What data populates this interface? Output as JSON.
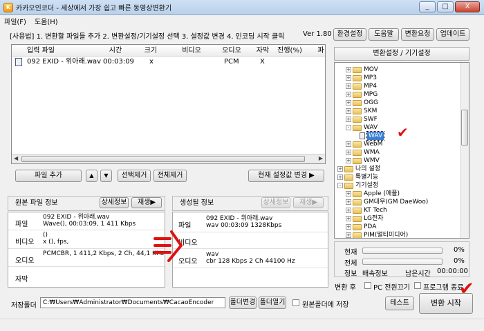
{
  "window": {
    "title": "카카오인코더 - 세상에서 가장 쉽고 빠른 동영상변환기",
    "controls": [
      "_",
      "□",
      "X"
    ]
  },
  "menu": [
    "파일(F)",
    "도움(H)"
  ],
  "instruction": "[사용법] 1. 변환할 파일들 추가  2. 변환설정/기기설정 선택  3. 설정값 변경  4. 인코딩 시작 클릭",
  "version": "Ver 1.80",
  "top_buttons": [
    "환경설정",
    "도움말",
    "변환요청",
    "업데이트"
  ],
  "file_list": {
    "columns": [
      "입력 파일",
      "시간",
      "크기",
      "비디오",
      "오디오",
      "자막",
      "진행(%)",
      "파"
    ],
    "rows": [
      {
        "file": "092 EXID - 위아래.wav",
        "time": "00:03:09",
        "size": "x",
        "video": "",
        "audio": "PCM",
        "subtitle": "X",
        "progress": ""
      }
    ]
  },
  "list_buttons": {
    "add_file": "파일 추가",
    "up": "▲",
    "down": "▼",
    "remove_selected": "선택제거",
    "remove_all": "전체제거",
    "apply_settings": "현재 설정값 변경 ▶"
  },
  "source_info": {
    "header": "원본 파일 정보",
    "details_btn": "상세정보",
    "play_btn": "재생▶",
    "rows": [
      {
        "label": "파일",
        "lines": [
          "092 EXID - 위아래.wav",
          "Wave(), 00:03:09, 1 411 Kbps"
        ]
      },
      {
        "label": "비디오",
        "lines": [
          "()",
          "x (), fps,"
        ]
      },
      {
        "label": "오디오",
        "lines": [
          "PCMCBR, 1 411,2 Kbps, 2 Ch, 44,1 KHz"
        ]
      },
      {
        "label": "자막",
        "lines": [
          ""
        ]
      }
    ]
  },
  "output_info": {
    "header": "생성될 정보",
    "details_btn": "상세정보",
    "play_btn": "재생▶",
    "rows": [
      {
        "label": "파일",
        "lines": [
          "092 EXID - 위아래.wav",
          "wav  00:03:09  1328Kbps"
        ]
      },
      {
        "label": "비디오",
        "lines": [
          ""
        ]
      },
      {
        "label": "오디오",
        "lines": [
          "wav",
          "cbr    128 Kbps   2 Ch   44100 Hz"
        ]
      }
    ]
  },
  "save": {
    "label": "저장폴더",
    "path": "C:₩Users₩Administrator₩Documents₩CacaoEncoder",
    "change_btn": "폴더변경",
    "open_btn": "폴더열기",
    "same_folder_label": "원본폴더에 저장"
  },
  "tree": {
    "header": "변환설정 / 기기설정",
    "items": [
      {
        "label": "MOV",
        "type": "folder",
        "expander": "+",
        "level": 1
      },
      {
        "label": "MP3",
        "type": "folder",
        "expander": "+",
        "level": 1
      },
      {
        "label": "MP4",
        "type": "folder",
        "expander": "+",
        "level": 1
      },
      {
        "label": "MPG",
        "type": "folder",
        "expander": "+",
        "level": 1
      },
      {
        "label": "OGG",
        "type": "folder",
        "expander": "+",
        "level": 1
      },
      {
        "label": "SKM",
        "type": "folder",
        "expander": "+",
        "level": 1
      },
      {
        "label": "SWF",
        "type": "folder",
        "expander": "+",
        "level": 1
      },
      {
        "label": "WAV",
        "type": "folder",
        "expander": "-",
        "level": 1
      },
      {
        "label": "WAV",
        "type": "doc",
        "expander": "",
        "level": 2,
        "selected": true
      },
      {
        "label": "WebM",
        "type": "folder",
        "expander": "+",
        "level": 1
      },
      {
        "label": "WMA",
        "type": "folder",
        "expander": "+",
        "level": 1
      },
      {
        "label": "WMV",
        "type": "folder",
        "expander": "+",
        "level": 1
      },
      {
        "label": "나의 설정",
        "type": "folder",
        "expander": "+",
        "level": 0
      },
      {
        "label": "특별기능",
        "type": "folder",
        "expander": "+",
        "level": 0
      },
      {
        "label": "기기설정",
        "type": "folder",
        "expander": "-",
        "level": 0
      },
      {
        "label": "Apple (애플)",
        "type": "folder",
        "expander": "+",
        "level": 1
      },
      {
        "label": "GM대우(GM DaeWoo)",
        "type": "folder",
        "expander": "+",
        "level": 1
      },
      {
        "label": "KT Tech",
        "type": "folder",
        "expander": "+",
        "level": 1
      },
      {
        "label": "LG전자",
        "type": "folder",
        "expander": "+",
        "level": 1
      },
      {
        "label": "PDA",
        "type": "folder",
        "expander": "+",
        "level": 1
      },
      {
        "label": "PIM(멀티미디어)",
        "type": "folder",
        "expander": "+",
        "level": 1
      }
    ]
  },
  "progress": {
    "current_label": "현재",
    "current_value": "0%",
    "current_fraction": 0,
    "total_label": "전체",
    "total_value": "0%",
    "total_fraction": 0,
    "info_label": "정보",
    "speed_label": "배속정보",
    "remaining_label": "남은시간",
    "remaining_value": "00:00:00"
  },
  "after": {
    "label": "변환 후",
    "pc_off": "PC 전원끄기",
    "exit": "프로그램 종료"
  },
  "test_btn": "테스트",
  "start_btn": "변환 시작",
  "colors": {
    "annotation": "#e01010",
    "selection": "#3b7fd3"
  }
}
